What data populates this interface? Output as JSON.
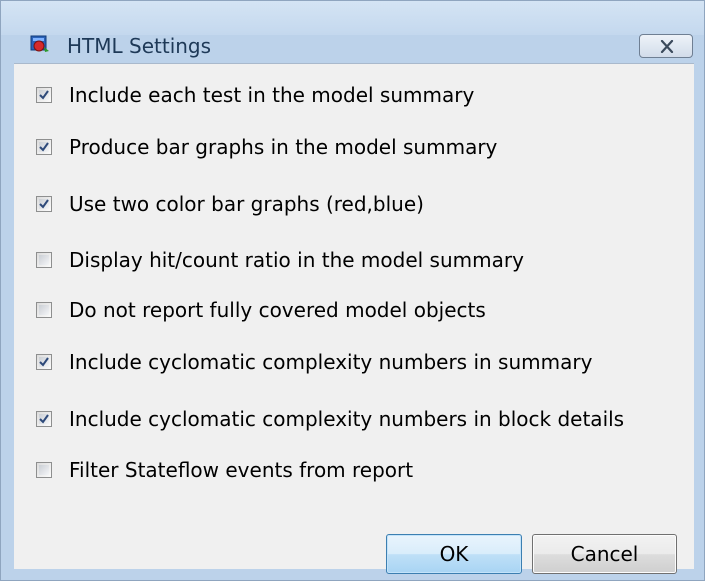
{
  "window": {
    "title": "HTML Settings",
    "close_icon": "close-icon"
  },
  "options": [
    {
      "label": "Include each test in the model summary",
      "checked": true
    },
    {
      "label": "Produce bar graphs in the model summary",
      "checked": true
    },
    {
      "label": "Use two color bar graphs (red,blue)",
      "checked": true
    },
    {
      "label": "Display hit/count ratio in the model summary",
      "checked": false
    },
    {
      "label": "Do not report fully covered model objects",
      "checked": false
    },
    {
      "label": "Include cyclomatic complexity numbers in summary",
      "checked": true
    },
    {
      "label": "Include cyclomatic complexity numbers in block details",
      "checked": true
    },
    {
      "label": "Filter Stateflow events from report",
      "checked": false
    }
  ],
  "buttons": {
    "ok_label": "OK",
    "cancel_label": "Cancel"
  },
  "colors": {
    "titlebar": "#c4d8ee",
    "client_bg": "#f0f0f0",
    "checkmark": "#2e4a7a"
  }
}
